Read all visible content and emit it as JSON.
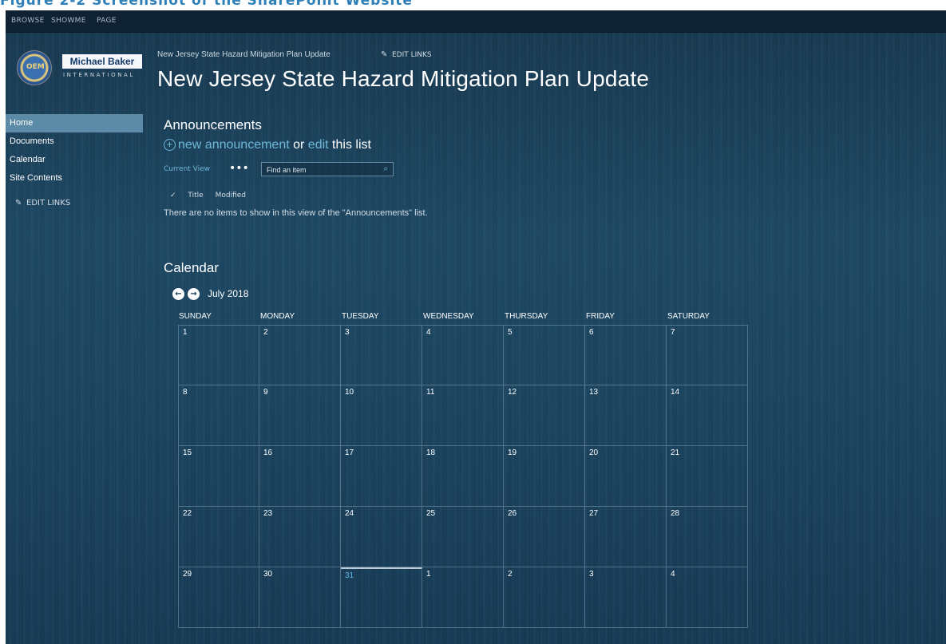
{
  "caption": "Figure 2-2 Screenshot of the SharePoint Website",
  "ribbon": {
    "tabs": [
      "BROWSE",
      "SHOWME",
      "PAGE"
    ]
  },
  "logo": {
    "seal": "OEM",
    "name": "Michael Baker",
    "sub": "INTERNATIONAL"
  },
  "sidebar": {
    "items": [
      {
        "label": "Home",
        "selected": true
      },
      {
        "label": "Documents"
      },
      {
        "label": "Calendar"
      },
      {
        "label": "Site Contents"
      }
    ],
    "edit_links": "EDIT LINKS"
  },
  "header": {
    "breadcrumb": "New Jersey State Hazard Mitigation Plan Update",
    "edit_links": "EDIT LINKS",
    "title": "New Jersey State Hazard Mitigation Plan Update"
  },
  "announcements": {
    "title": "Announcements",
    "new_link": "new announcement",
    "or_text": "or",
    "edit_link": "edit",
    "suffix": "this list",
    "current_view": "Current View",
    "ellipsis": "•••",
    "search_placeholder": "Find an item",
    "columns": [
      "✓",
      "Title",
      "Modified"
    ],
    "empty_message": "There are no items to show in this view of the \"Announcements\" list."
  },
  "calendar": {
    "title": "Calendar",
    "month": "July 2018",
    "days": [
      "SUNDAY",
      "MONDAY",
      "TUESDAY",
      "WEDNESDAY",
      "THURSDAY",
      "FRIDAY",
      "SATURDAY"
    ],
    "weeks": [
      [
        "1",
        "2",
        "3",
        "4",
        "5",
        "6",
        "7"
      ],
      [
        "8",
        "9",
        "10",
        "11",
        "12",
        "13",
        "14"
      ],
      [
        "15",
        "16",
        "17",
        "18",
        "19",
        "20",
        "21"
      ],
      [
        "22",
        "23",
        "24",
        "25",
        "26",
        "27",
        "28"
      ],
      [
        "29",
        "30",
        "31",
        "1",
        "2",
        "3",
        "4"
      ]
    ],
    "today": "31"
  },
  "colors": {
    "accent": "#6fb8da",
    "selected_nav": "#5c8ba8",
    "today": "#5fb6e0"
  }
}
